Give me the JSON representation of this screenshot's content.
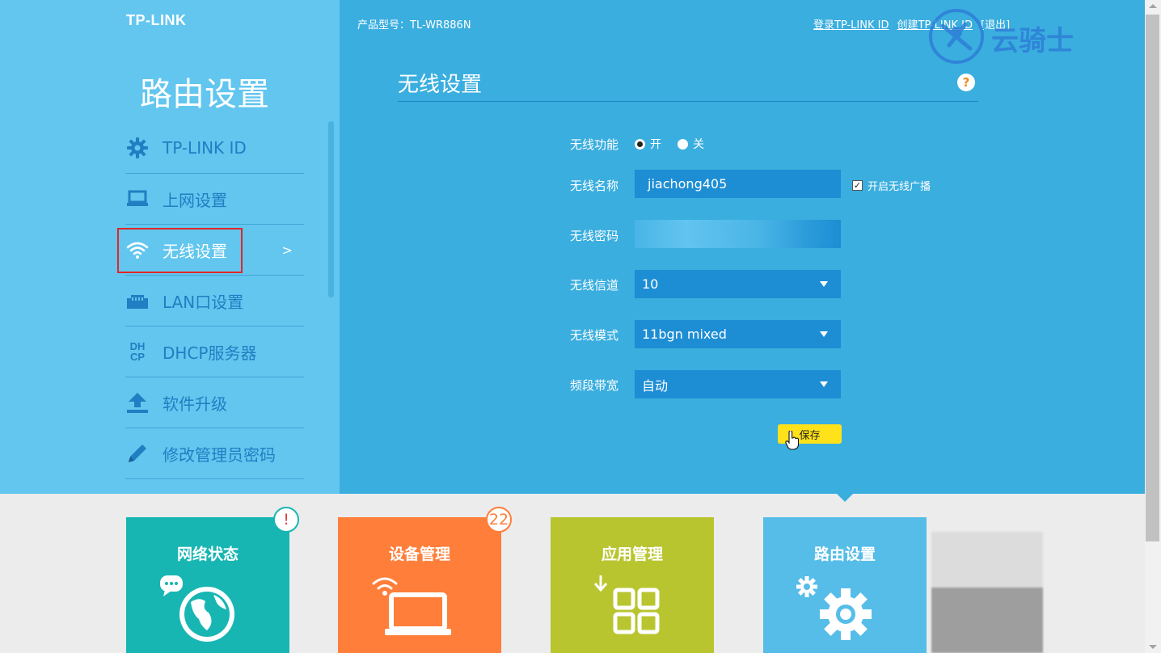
{
  "brand": {
    "logo": "TP-LINK"
  },
  "sidebar": {
    "title": "路由设置",
    "items": [
      {
        "label": "TP-LINK ID",
        "icon": "gear-icon"
      },
      {
        "label": "上网设置",
        "icon": "laptop-icon"
      },
      {
        "label": "无线设置",
        "icon": "wifi-icon",
        "active": true,
        "arrow": ">"
      },
      {
        "label": "LAN口设置",
        "icon": "lan-port-icon"
      },
      {
        "label": "DHCP服务器",
        "icon": "dhcp-icon",
        "icon_text_top": "DH",
        "icon_text_bottom": "CP"
      },
      {
        "label": "软件升级",
        "icon": "upload-icon"
      },
      {
        "label": "修改管理员密码",
        "icon": "pencil-icon"
      }
    ]
  },
  "header": {
    "model": "产品型号：TL-WR886N",
    "links": {
      "login": "登录TP-LINK ID",
      "create": "创建TP-LINK ID",
      "logout": "[退出]"
    }
  },
  "watermark": {
    "text": "云骑士"
  },
  "form": {
    "title": "无线设置",
    "help": "?",
    "wireless_function": {
      "label": "无线功能",
      "on": "开",
      "off": "关",
      "value": "on"
    },
    "ssid": {
      "label": "无线名称",
      "value": "jiachong405"
    },
    "broadcast": {
      "label": "开启无线广播",
      "checked": true,
      "check_glyph": "✓"
    },
    "password": {
      "label": "无线密码",
      "value": ""
    },
    "channel": {
      "label": "无线信道",
      "value": "10"
    },
    "mode": {
      "label": "无线模式",
      "value": "11bgn mixed"
    },
    "bandwidth": {
      "label": "频段带宽",
      "value": "自动"
    },
    "save_label": "保存"
  },
  "tiles": [
    {
      "title": "网络状态",
      "color": "#17b6b3",
      "badge": "!",
      "badge_color": "#e0404a",
      "icon": "globe-chat-icon"
    },
    {
      "title": "设备管理",
      "color": "#ff7e3a",
      "badge": "22",
      "badge_color": "#ff7e3a",
      "icon": "laptop-wifi-icon"
    },
    {
      "title": "应用管理",
      "color": "#b8c52f",
      "icon": "apps-grid-icon"
    },
    {
      "title": "路由设置",
      "color": "#56bde8",
      "icon": "gears-icon"
    }
  ],
  "colors": {
    "sidebar_bg": "#62c6ef",
    "main_bg": "#3aaedf",
    "field_bg": "#1d8ed4",
    "save_btn": "#ffe21a",
    "highlight_box": "#e12525"
  }
}
